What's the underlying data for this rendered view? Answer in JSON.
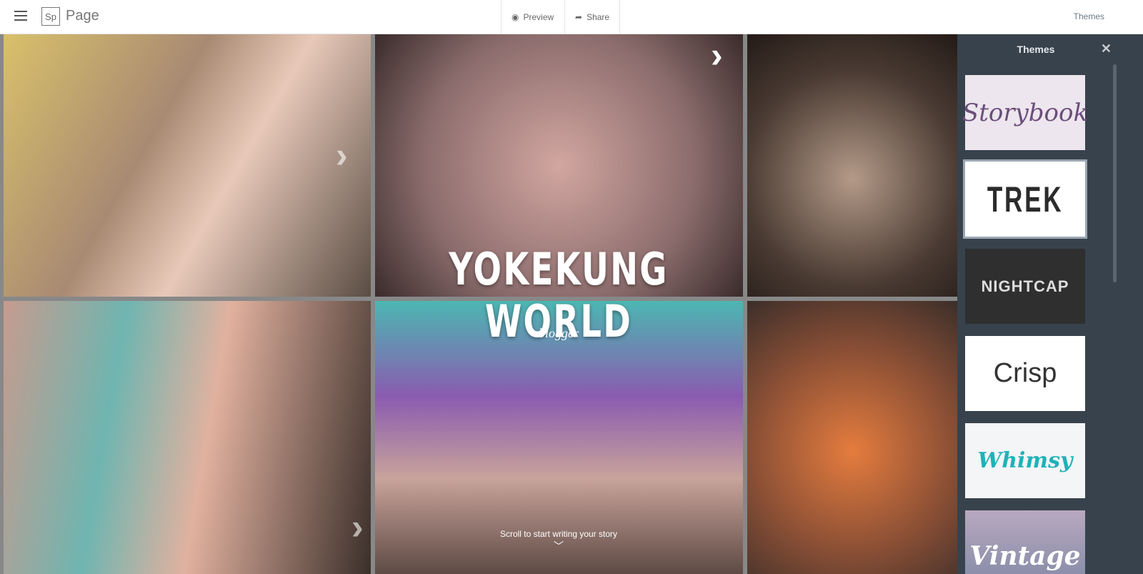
{
  "header": {
    "app_logo": "Sp",
    "app_name": "Page",
    "preview": "Preview",
    "share": "Share",
    "themes": "Themes"
  },
  "story": {
    "title": "YOKEKUNG WORLD",
    "subtitle": "blogger",
    "scroll_hint": "Scroll to start writing your story"
  },
  "panel": {
    "title": "Themes",
    "themes": [
      {
        "label": "Storybook"
      },
      {
        "label": "TREK",
        "selected": true
      },
      {
        "label": "NIGHTCAP"
      },
      {
        "label": "Crisp"
      },
      {
        "label": "Whimsy"
      },
      {
        "label": "Vintage"
      }
    ]
  }
}
